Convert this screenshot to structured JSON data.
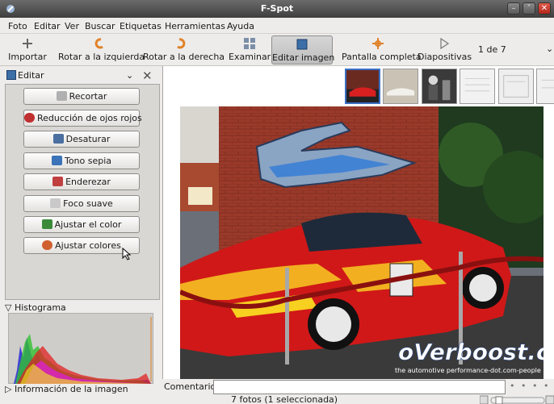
{
  "window": {
    "title": "F-Spot"
  },
  "menu": [
    "Foto",
    "Editar",
    "Ver",
    "Buscar",
    "Etiquetas",
    "Herramientas",
    "Ayuda"
  ],
  "toolbar": {
    "import": "Importar",
    "rotate_left": "Rotar a la izquierda",
    "rotate_right": "Rotar a la derecha",
    "browse": "Examinar",
    "edit_image": "Editar imagen",
    "fullscreen": "Pantalla completa",
    "slideshow": "Diapositivas",
    "counter": "1 de 7"
  },
  "sidebar": {
    "selector": "Editar",
    "tools": [
      {
        "label": "Recortar",
        "icon": "crop-icon",
        "color": "#b0b0b0"
      },
      {
        "label": "Reducción de ojos rojos",
        "icon": "red-eye-icon",
        "color": "#c03030"
      },
      {
        "label": "Desaturar",
        "icon": "desaturate-icon",
        "color": "#4a6fa0"
      },
      {
        "label": "Tono sepia",
        "icon": "sepia-icon",
        "color": "#3b74b8"
      },
      {
        "label": "Enderezar",
        "icon": "straighten-icon",
        "color": "#c04040"
      },
      {
        "label": "Foco suave",
        "icon": "soft-focus-icon",
        "color": "#c9c9c9"
      },
      {
        "label": "Ajustar el color",
        "icon": "adjust-color-icon",
        "color": "#3a8a3a"
      },
      {
        "label": "Ajustar colores",
        "icon": "adjust-colors-icon",
        "color": "#d06030"
      }
    ],
    "histogram_label": "Histograma",
    "info_label": "Información de la imagen"
  },
  "photo": {
    "watermark": "oVerboost.com",
    "watermark_sub": "the automotive performance-dot.com-people"
  },
  "comment_label": "Comentario:",
  "status": "7 fotos (1 seleccionada)"
}
